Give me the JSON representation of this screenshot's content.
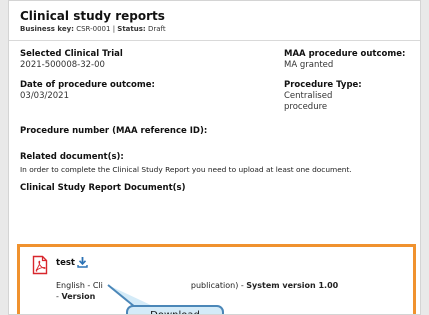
{
  "header": {
    "title": "Clinical study reports",
    "business_key_label": "Business key:",
    "business_key": "CSR-0001",
    "separator": "|",
    "status_label": "Status:",
    "status": "Draft"
  },
  "fields": {
    "selected_trial_label": "Selected Clinical Trial",
    "selected_trial_value": "2021-500008-32-00",
    "maa_outcome_label": "MAA procedure outcome:",
    "maa_outcome_value": "MA granted",
    "date_outcome_label": "Date of procedure outcome:",
    "date_outcome_value": "03/03/2021",
    "procedure_type_label": "Procedure Type:",
    "procedure_type_value_line1": "Centralised",
    "procedure_type_value_line2": "procedure",
    "procedure_number_label": "Procedure number (MAA reference ID):",
    "related_docs_label": "Related document(s):",
    "related_docs_info": "In order to complete the Clinical Study Report you need to upload at least one document.",
    "csr_document_label": "Clinical Study Report Document(s)"
  },
  "document": {
    "name": "test",
    "icon": "pdf-icon",
    "download_icon": "download-icon",
    "line1_left": "English - Cli",
    "line1_mid": "publication) - ",
    "line1_version_label": "System version 1.00",
    "line2_prefix": "- ",
    "line2_label": "Version"
  },
  "tooltip": {
    "text": "Download"
  },
  "colors": {
    "highlight_border": "#f0922e",
    "tooltip_bg": "#d4ebf8",
    "tooltip_border": "#4b87b8",
    "pdf_red": "#d8262c",
    "download_blue": "#2b72b5"
  }
}
